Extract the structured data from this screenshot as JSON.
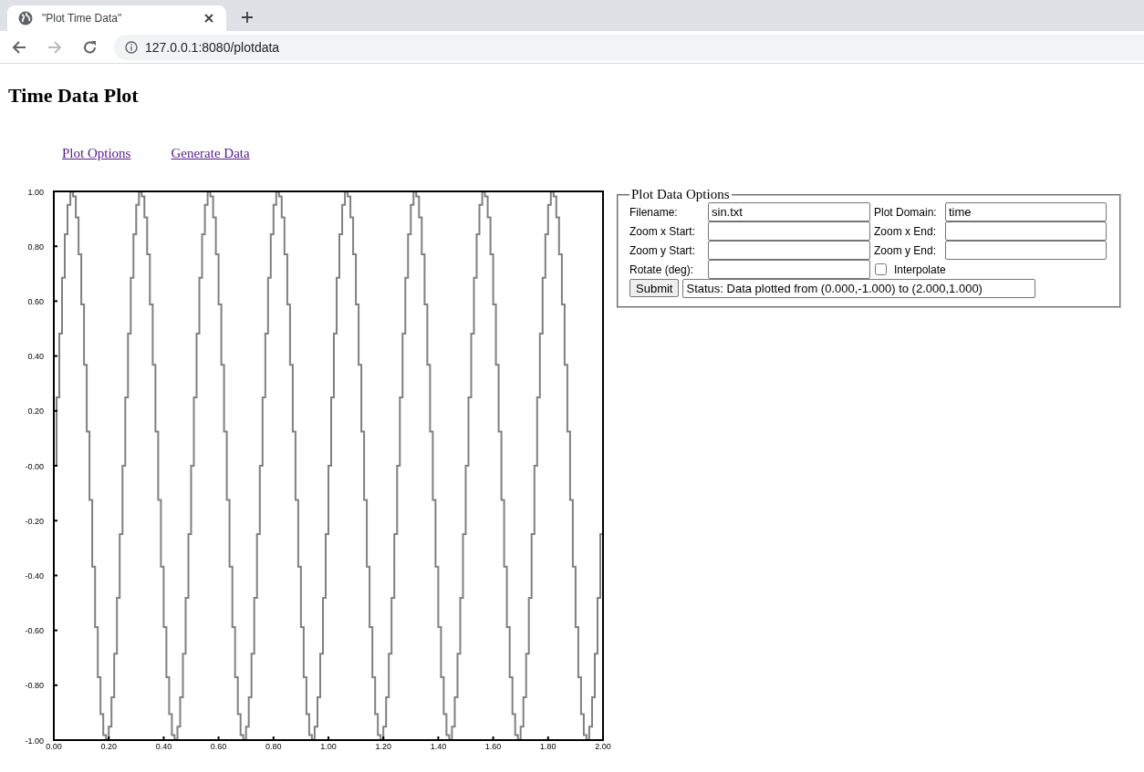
{
  "browser": {
    "tab": {
      "title": "\"Plot Time Data\"",
      "selected": true
    },
    "nav": [
      {
        "kind": "back",
        "disabled": false
      },
      {
        "kind": "forward",
        "disabled": true
      },
      {
        "kind": "reload",
        "disabled": false
      }
    ],
    "address": {
      "url": "127.0.0.1:8080/plotdata"
    }
  },
  "page": {
    "heading": "Time Data Plot",
    "links": [
      "Plot Options",
      "Generate Data"
    ],
    "plot": {
      "chart_data": {
        "type": "line",
        "x": [
          0,
          0.01,
          0.02,
          0.03,
          0.04,
          0.05,
          0.06,
          0.07,
          0.08,
          0.09,
          0.1,
          0.11,
          0.12,
          0.13,
          0.14,
          0.15,
          0.16,
          0.17,
          0.18,
          0.19,
          0.2,
          0.21,
          0.22,
          0.23,
          0.24,
          0.25,
          0.26,
          0.27,
          0.28,
          0.29,
          0.3,
          0.31,
          0.32,
          0.33,
          0.34,
          0.35,
          0.36,
          0.37,
          0.38,
          0.39,
          0.4,
          0.41,
          0.42,
          0.43,
          0.44,
          0.45,
          0.46,
          0.47,
          0.48,
          0.49,
          0.5,
          0.51,
          0.52,
          0.53,
          0.54,
          0.55,
          0.56,
          0.57,
          0.58,
          0.59,
          0.6,
          0.61,
          0.62,
          0.63,
          0.64,
          0.65,
          0.66,
          0.67,
          0.68,
          0.69,
          0.7,
          0.71,
          0.72,
          0.73,
          0.74,
          0.75,
          0.76,
          0.77,
          0.78,
          0.79,
          0.8,
          0.81,
          0.82,
          0.83,
          0.84,
          0.85,
          0.86,
          0.87,
          0.88,
          0.89,
          0.9,
          0.91,
          0.92,
          0.93,
          0.94,
          0.95,
          0.96,
          0.97,
          0.98,
          0.99,
          1,
          1.01,
          1.02,
          1.03,
          1.04,
          1.05,
          1.06,
          1.07,
          1.08,
          1.09,
          1.1,
          1.11,
          1.12,
          1.13,
          1.14,
          1.15,
          1.16,
          1.17,
          1.18,
          1.19,
          1.2,
          1.21,
          1.22,
          1.23,
          1.24,
          1.25,
          1.26,
          1.27,
          1.28,
          1.29,
          1.3,
          1.31,
          1.32,
          1.33,
          1.34,
          1.35,
          1.36,
          1.37,
          1.38,
          1.39,
          1.4,
          1.41,
          1.42,
          1.43,
          1.44,
          1.45,
          1.46,
          1.47,
          1.48,
          1.49,
          1.5,
          1.51,
          1.52,
          1.53,
          1.54,
          1.55,
          1.56,
          1.57,
          1.58,
          1.59,
          1.6,
          1.61,
          1.62,
          1.63,
          1.64,
          1.65,
          1.66,
          1.67,
          1.68,
          1.69,
          1.7,
          1.71,
          1.72,
          1.73,
          1.74,
          1.75,
          1.76,
          1.77,
          1.78,
          1.79,
          1.8,
          1.81,
          1.82,
          1.83,
          1.84,
          1.85,
          1.86,
          1.87,
          1.88,
          1.89,
          1.9,
          1.91,
          1.92,
          1.93,
          1.94,
          1.95,
          1.96,
          1.97,
          1.98,
          1.99,
          2
        ],
        "xlim": [
          0,
          2
        ],
        "ylim": [
          -1,
          1
        ],
        "xticks": [
          {
            "value": 0,
            "label": "0.00"
          },
          {
            "value": 0.2,
            "label": "0.20"
          },
          {
            "value": 0.4,
            "label": "0.40"
          },
          {
            "value": 0.6,
            "label": "0.60"
          },
          {
            "value": 0.8,
            "label": "0.80"
          },
          {
            "value": 1,
            "label": "1.00"
          },
          {
            "value": 1.2,
            "label": "1.20"
          },
          {
            "value": 1.4,
            "label": "1.40"
          },
          {
            "value": 1.6,
            "label": "1.60"
          },
          {
            "value": 1.8,
            "label": "1.80"
          },
          {
            "value": 2,
            "label": "2.00"
          }
        ],
        "yticks": [
          {
            "value": 1,
            "label": "1.00"
          },
          {
            "value": 0.8,
            "label": "0.80"
          },
          {
            "value": 0.6,
            "label": "0.60"
          },
          {
            "value": 0.4,
            "label": "0.40"
          },
          {
            "value": 0.2,
            "label": "0.20"
          },
          {
            "value": 0,
            "label": "-0.00"
          },
          {
            "value": -0.2,
            "label": "-0.20"
          },
          {
            "value": -0.4,
            "label": "-0.40"
          },
          {
            "value": -0.6,
            "label": "-0.60"
          },
          {
            "value": -0.8,
            "label": "-0.80"
          },
          {
            "value": -1,
            "label": "-1.00"
          }
        ],
        "series": [
          {
            "color": "#808080",
            "values": [
              0,
              0.249,
              0.482,
              0.685,
              0.844,
              0.951,
              0.998,
              0.982,
              0.905,
              0.771,
              0.588,
              0.368,
              0.125,
              -0.125,
              -0.368,
              -0.588,
              -0.771,
              -0.905,
              -0.982,
              -0.998,
              -0.951,
              -0.844,
              -0.685,
              -0.482,
              -0.249,
              0,
              0.249,
              0.482,
              0.685,
              0.844,
              0.951,
              0.998,
              0.982,
              0.905,
              0.771,
              0.588,
              0.368,
              0.125,
              -0.125,
              -0.368,
              -0.588,
              -0.771,
              -0.905,
              -0.982,
              -0.998,
              -0.951,
              -0.844,
              -0.685,
              -0.482,
              -0.249,
              0,
              0.249,
              0.482,
              0.685,
              0.844,
              0.951,
              0.998,
              0.982,
              0.905,
              0.771,
              0.588,
              0.368,
              0.125,
              -0.125,
              -0.368,
              -0.588,
              -0.771,
              -0.905,
              -0.982,
              -0.998,
              -0.951,
              -0.844,
              -0.685,
              -0.482,
              -0.249,
              0,
              0.249,
              0.482,
              0.685,
              0.844,
              0.951,
              0.998,
              0.982,
              0.905,
              0.771,
              0.588,
              0.368,
              0.125,
              -0.125,
              -0.368,
              -0.588,
              -0.771,
              -0.905,
              -0.982,
              -0.998,
              -0.951,
              -0.844,
              -0.685,
              -0.482,
              -0.249,
              0,
              0.249,
              0.482,
              0.685,
              0.844,
              0.951,
              0.998,
              0.982,
              0.905,
              0.771,
              0.588,
              0.368,
              0.125,
              -0.125,
              -0.368,
              -0.588,
              -0.771,
              -0.905,
              -0.982,
              -0.998,
              -0.951,
              -0.844,
              -0.685,
              -0.482,
              -0.249,
              0,
              0.249,
              0.482,
              0.685,
              0.844,
              0.951,
              0.998,
              0.982,
              0.905,
              0.771,
              0.588,
              0.368,
              0.125,
              -0.125,
              -0.368,
              -0.588,
              -0.771,
              -0.905,
              -0.982,
              -0.998,
              -0.951,
              -0.844,
              -0.685,
              -0.482,
              -0.249,
              0,
              0.249,
              0.482,
              0.685,
              0.844,
              0.951,
              0.998,
              0.982,
              0.905,
              0.771,
              0.588,
              0.368,
              0.125,
              -0.125,
              -0.368,
              -0.588,
              -0.771,
              -0.905,
              -0.982,
              -0.998,
              -0.951,
              -0.844,
              -0.685,
              -0.482,
              -0.249,
              0,
              0.249,
              0.482,
              0.685,
              0.844,
              0.951,
              0.998,
              0.982,
              0.905,
              0.771,
              0.588,
              0.368,
              0.125,
              -0.125,
              -0.368,
              -0.588,
              -0.771,
              -0.905,
              -0.982,
              -0.998,
              -0.951,
              -0.844,
              -0.685,
              -0.482,
              -0.249,
              0
            ]
          }
        ]
      }
    },
    "options": {
      "legend": "Plot Data Options",
      "fields": [
        {
          "kind": "text",
          "label": "Filename:",
          "value": "sin.txt"
        },
        {
          "kind": "text",
          "label": "Plot Domain:",
          "value": "time"
        },
        {
          "kind": "text",
          "label": "Zoom x Start:"
        },
        {
          "kind": "text",
          "label": "Zoom x End:"
        },
        {
          "kind": "text",
          "label": "Zoom y Start:"
        },
        {
          "kind": "text",
          "label": "Zoom y End:"
        },
        {
          "kind": "text",
          "label": "Rotate (deg):"
        },
        {
          "kind": "checkbox",
          "label": "Interpolate",
          "checked": false
        }
      ],
      "submit": {
        "label": "Submit"
      },
      "status": {
        "value": "Status: Data plotted from (0.000,-1.000) to (2.000,1.000)"
      }
    }
  }
}
